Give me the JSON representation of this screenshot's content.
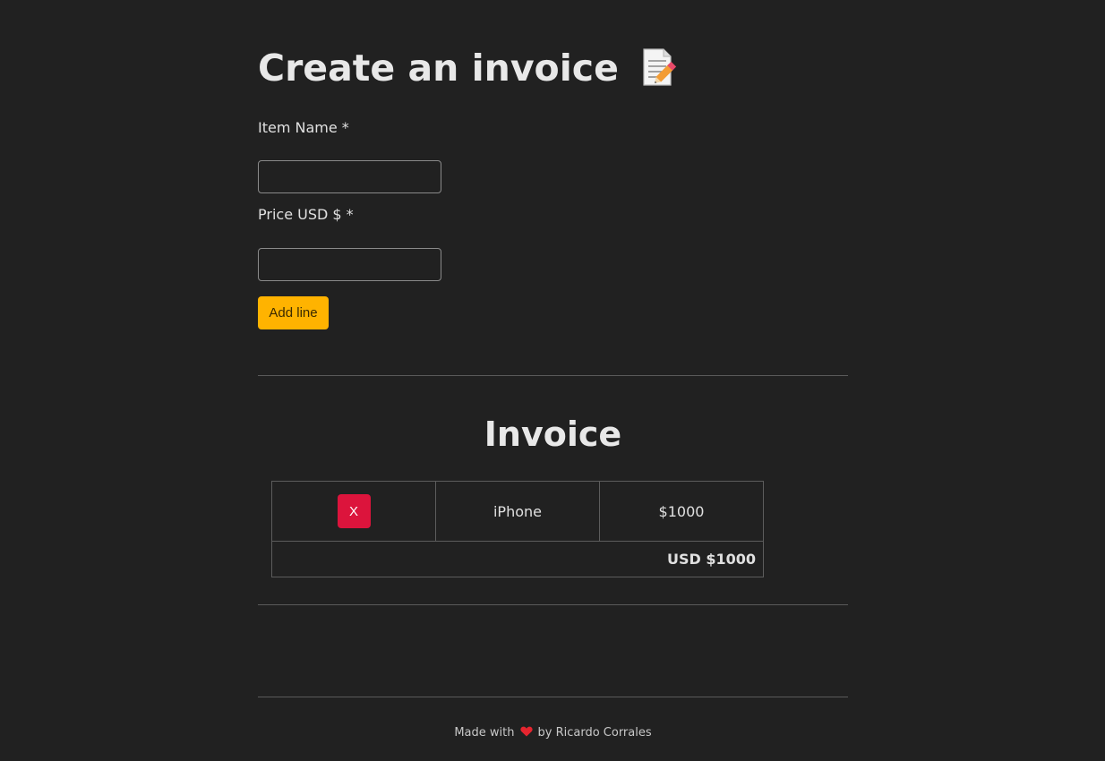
{
  "page": {
    "title": "Create an invoice",
    "title_icon": "memo-icon"
  },
  "form": {
    "item_name_label": "Item Name *",
    "item_name_value": "",
    "price_label": "Price USD $ *",
    "price_value": "",
    "add_button_label": "Add line",
    "add_button_color": "#ffb300"
  },
  "invoice": {
    "heading": "Invoice",
    "lines": [
      {
        "remove_label": "X",
        "item": "iPhone",
        "price": "$1000"
      }
    ],
    "total": "USD $1000",
    "remove_button_color": "#dc143c"
  },
  "footer": {
    "made_with": "Made with",
    "heart_icon": "heart-icon",
    "by": "by Ricardo Corrales"
  },
  "colors": {
    "background": "#212121",
    "text": "#e6e6e6",
    "divider": "#5a5a5a"
  }
}
